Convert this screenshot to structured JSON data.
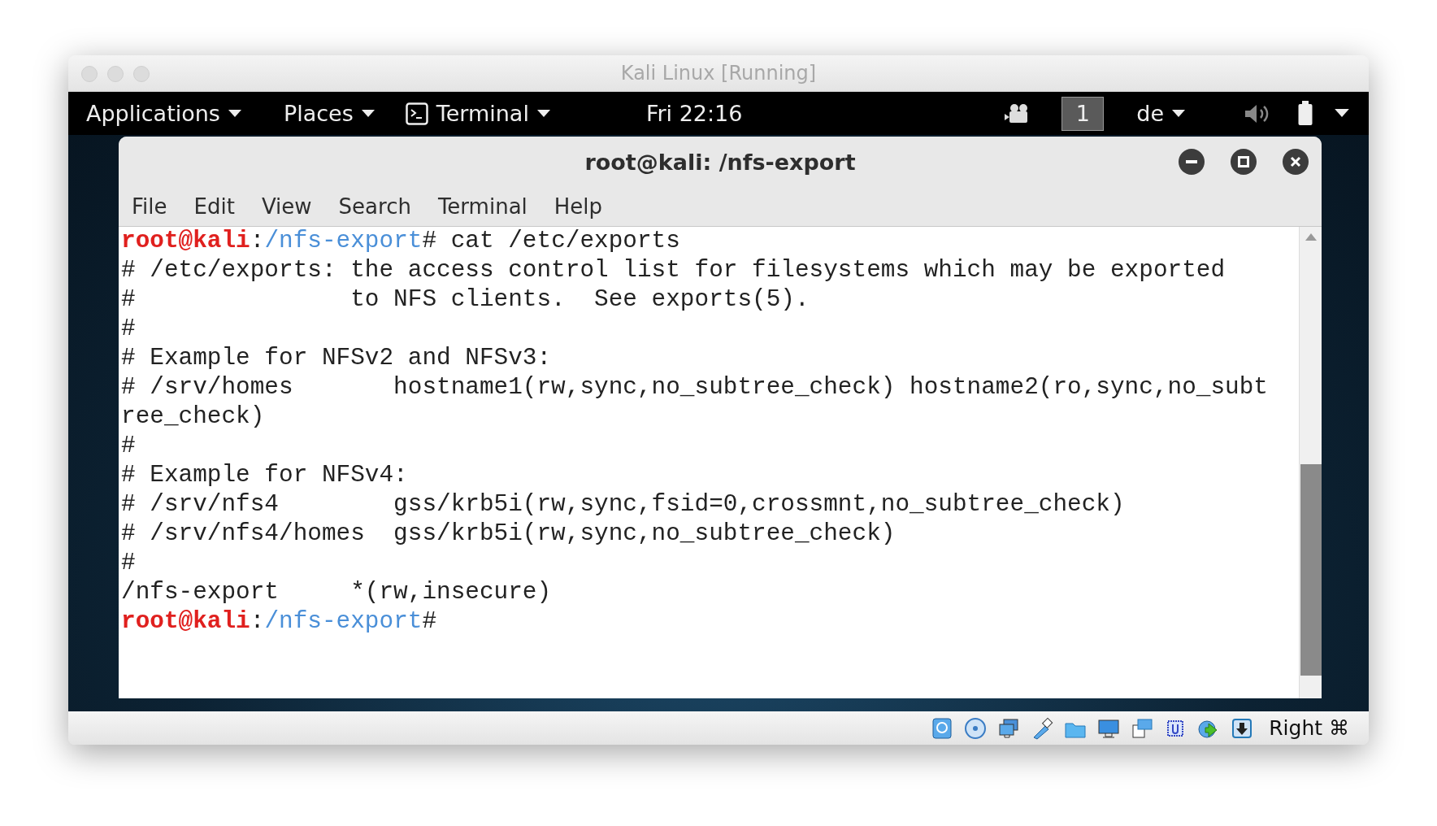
{
  "window": {
    "title": "Kali Linux [Running]"
  },
  "top_bar": {
    "menus": [
      {
        "label": "Applications",
        "kind": "menu"
      },
      {
        "label": "Places",
        "kind": "menu"
      },
      {
        "label": "Terminal",
        "kind": "app"
      }
    ],
    "clock": "Fri 22:16",
    "workspace": "1",
    "keyboard": "de"
  },
  "terminal": {
    "title": "root@kali: /nfs-export",
    "menu": [
      "File",
      "Edit",
      "View",
      "Search",
      "Terminal",
      "Help"
    ],
    "lines": [
      {
        "kind": "prompt",
        "user": "root@kali",
        "sep": ":",
        "path": "/nfs-export",
        "text": "# cat /etc/exports"
      },
      {
        "kind": "text",
        "text": "# /etc/exports: the access control list for filesystems which may be exported"
      },
      {
        "kind": "text",
        "text": "#               to NFS clients.  See exports(5)."
      },
      {
        "kind": "text",
        "text": "#"
      },
      {
        "kind": "text",
        "text": "# Example for NFSv2 and NFSv3:"
      },
      {
        "kind": "text",
        "text": "# /srv/homes       hostname1(rw,sync,no_subtree_check) hostname2(ro,sync,no_subt"
      },
      {
        "kind": "text",
        "text": "ree_check)"
      },
      {
        "kind": "text",
        "text": "#"
      },
      {
        "kind": "text",
        "text": "# Example for NFSv4:"
      },
      {
        "kind": "text",
        "text": "# /srv/nfs4        gss/krb5i(rw,sync,fsid=0,crossmnt,no_subtree_check)"
      },
      {
        "kind": "text",
        "text": "# /srv/nfs4/homes  gss/krb5i(rw,sync,no_subtree_check)"
      },
      {
        "kind": "text",
        "text": "#"
      },
      {
        "kind": "text",
        "text": "/nfs-export     *(rw,insecure)"
      },
      {
        "kind": "prompt",
        "user": "root@kali",
        "sep": ":",
        "path": "/nfs-export",
        "text": "#"
      }
    ]
  },
  "status_bar": {
    "host_key": "Right ⌘"
  }
}
